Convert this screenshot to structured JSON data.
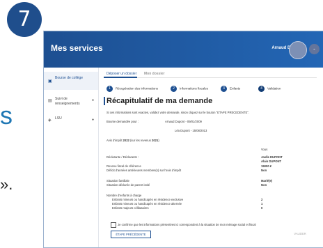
{
  "step_badge": "7",
  "left_fragments": {
    "s": "s",
    "quote": "»."
  },
  "app": {
    "title": "Mes services",
    "user": "Arnaud D.",
    "avatar_btn": "-"
  },
  "sidebar": {
    "items": [
      {
        "label": "Bourse de collège",
        "icon": "school-icon"
      },
      {
        "label": "Suivi de renseignements",
        "icon": "document-icon"
      },
      {
        "label": "LSU",
        "icon": "book-icon"
      }
    ]
  },
  "tabs": [
    {
      "label": "Déposer un dossier"
    },
    {
      "label": "Mon dossier"
    }
  ],
  "steps": [
    {
      "num": "1",
      "label": "Récupération des informations"
    },
    {
      "num": "2",
      "label": "Informations fiscales"
    },
    {
      "num": "3",
      "label": "Enfants"
    },
    {
      "num": "4",
      "label": "Validation"
    }
  ],
  "page_title": "Récapitulatif de ma demande",
  "intro": "Si ces informations sont exactes, validez votre demande, sinon cliquez sur le bouton \"ETAPE PRECEDENTE\".",
  "bourse": {
    "label": "Bourse demandée pour :",
    "v1": "Arnaud Dupont - 09/01/2009",
    "v2": "Léa Dupont - 15/08/2013"
  },
  "avis": {
    "prefix": "Avis d'impôt ",
    "year": "2022",
    "middle": " (sur les revenus ",
    "rev": "2021",
    "suffix": ")"
  },
  "vous": "Vous",
  "declarants": {
    "label": "Déclarante / Déclarants :",
    "v1": "Joelle DUPONT",
    "v2": "Alain DUPONT"
  },
  "revenu": {
    "label": "Revenu fiscal de référence",
    "value": "15000 €"
  },
  "deficit": {
    "label": "Déficit d'années antérieures membres(s) sur l'avis d'impôt",
    "value": "Non"
  },
  "situation": {
    "label": "Situation familiale",
    "value": "Marié(e)"
  },
  "parent_isole": {
    "label": "Situation déclarée de parent isolé",
    "value": "Non"
  },
  "enfants": {
    "title": "Nombre d'enfants à charge",
    "rows": [
      {
        "label": "Enfants mineurs ou handicapés en résidence exclusive",
        "value": "2"
      },
      {
        "label": "Enfants mineurs ou handicapés en résidence alternée",
        "value": "1"
      },
      {
        "label": "Enfants majeurs célibataires",
        "value": "0"
      }
    ]
  },
  "confirm": "Je confirme que les informations présentées ici correspondent à la situation de mon ménage social et fiscal",
  "buttons": {
    "prev": "ÉTAPE PRÉCÉDENTE",
    "validate": "VALIDER"
  },
  "colors": {
    "brand": "#1d4f91",
    "badge": "#1f4e8c",
    "accent_text": "#1f77b4"
  }
}
